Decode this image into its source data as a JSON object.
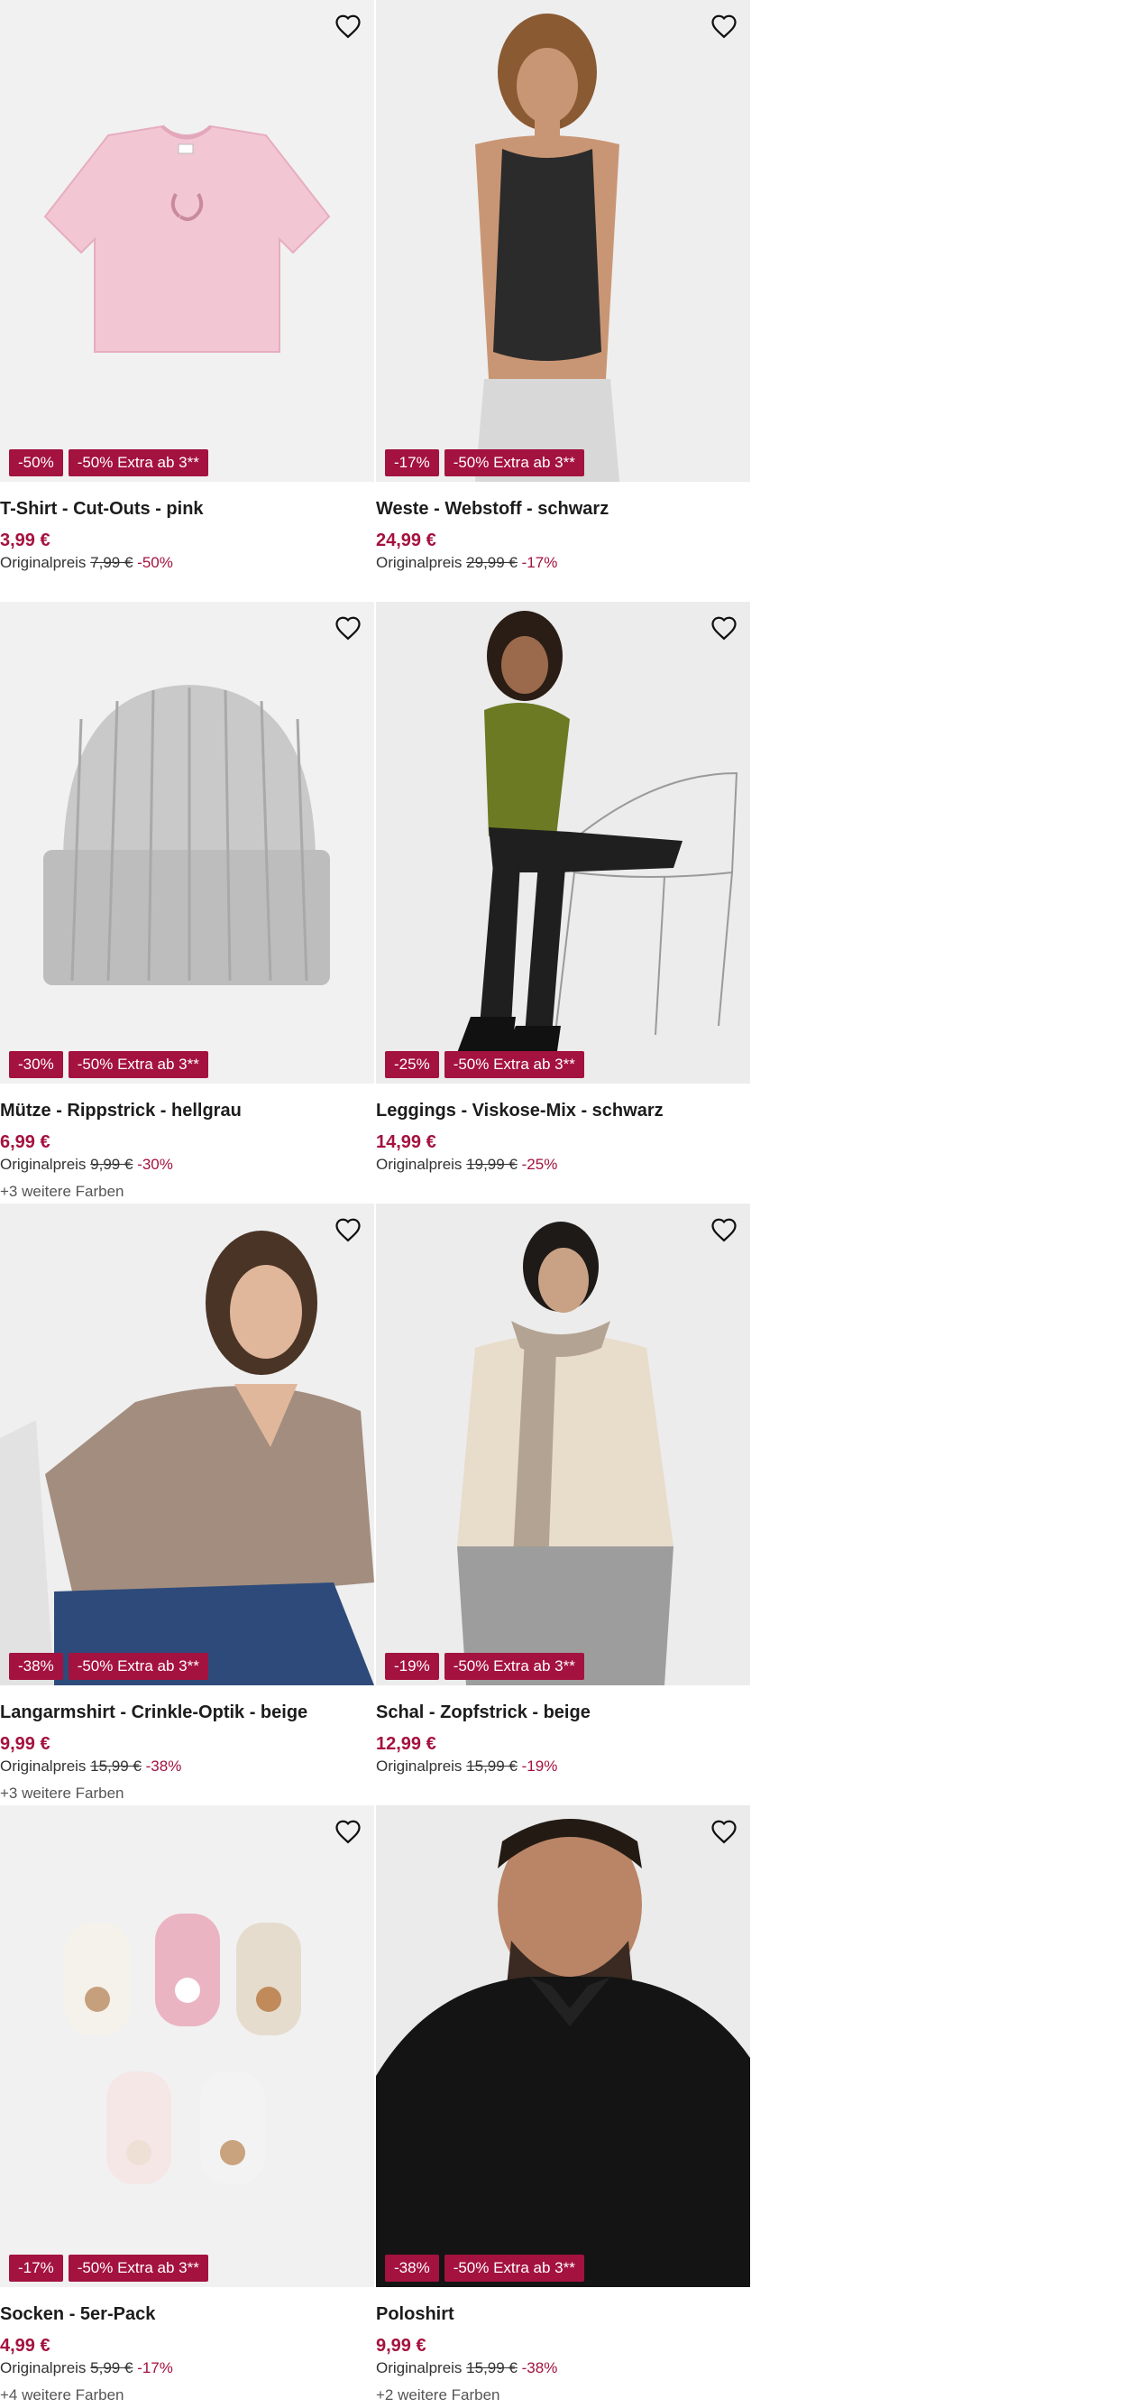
{
  "wishlist_icon": "heart-outline-icon",
  "accent_color": "#a4123f",
  "products": [
    {
      "title": "T-Shirt - Cut-Outs - pink",
      "price": "3,99 €",
      "orig_label": "Originalpreis",
      "orig_price": "7,99 €",
      "discount": "-50%",
      "badge_discount": "-50%",
      "badge_extra": "-50% Extra ab 3**",
      "more_colors": ""
    },
    {
      "title": "Weste - Webstoff - schwarz",
      "price": "24,99 €",
      "orig_label": "Originalpreis",
      "orig_price": "29,99 €",
      "discount": "-17%",
      "badge_discount": "-17%",
      "badge_extra": "-50% Extra ab 3**",
      "more_colors": ""
    },
    {
      "title": "Mütze - Rippstrick - hellgrau",
      "price": "6,99 €",
      "orig_label": "Originalpreis",
      "orig_price": "9,99 €",
      "discount": "-30%",
      "badge_discount": "-30%",
      "badge_extra": "-50% Extra ab 3**",
      "more_colors": "+3 weitere Farben"
    },
    {
      "title": "Leggings - Viskose-Mix - schwarz",
      "price": "14,99 €",
      "orig_label": "Originalpreis",
      "orig_price": "19,99 €",
      "discount": "-25%",
      "badge_discount": "-25%",
      "badge_extra": "-50% Extra ab 3**",
      "more_colors": ""
    },
    {
      "title": "Langarmshirt - Crinkle-Optik - beige",
      "price": "9,99 €",
      "orig_label": "Originalpreis",
      "orig_price": "15,99 €",
      "discount": "-38%",
      "badge_discount": "-38%",
      "badge_extra": "-50% Extra ab 3**",
      "more_colors": "+3 weitere Farben"
    },
    {
      "title": "Schal - Zopfstrick - beige",
      "price": "12,99 €",
      "orig_label": "Originalpreis",
      "orig_price": "15,99 €",
      "discount": "-19%",
      "badge_discount": "-19%",
      "badge_extra": "-50% Extra ab 3**",
      "more_colors": ""
    },
    {
      "title": "Socken - 5er-Pack",
      "price": "4,99 €",
      "orig_label": "Originalpreis",
      "orig_price": "5,99 €",
      "discount": "-17%",
      "badge_discount": "-17%",
      "badge_extra": "-50% Extra ab 3**",
      "more_colors": "+4 weitere Farben"
    },
    {
      "title": "Poloshirt",
      "price": "9,99 €",
      "orig_label": "Originalpreis",
      "orig_price": "15,99 €",
      "discount": "-38%",
      "badge_discount": "-38%",
      "badge_extra": "-50% Extra ab 3**",
      "more_colors": "+2 weitere Farben"
    }
  ]
}
